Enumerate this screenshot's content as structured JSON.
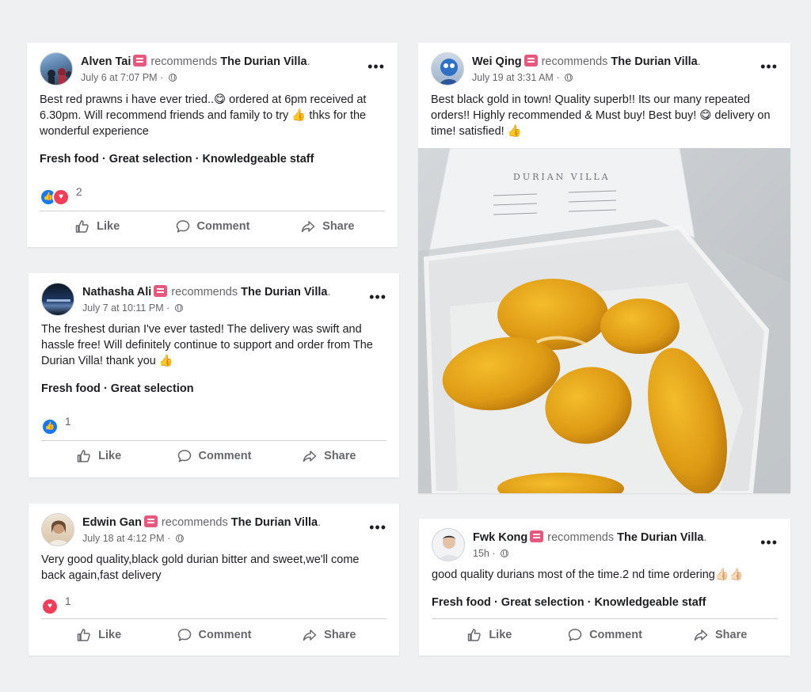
{
  "posts": [
    {
      "author": "Alven Tai",
      "recommends": "recommends",
      "page": "The Durian Villa",
      "date": "July 6 at 7:07 PM",
      "text": "Best red prawns i have ever tried..😋 ordered at 6pm received at 6.30pm. Will recommend friends and family to try 👍 thks for the wonderful experience",
      "tags": "Fresh food · Great selection · Knowledgeable staff",
      "reaction_count": "2",
      "reactions": [
        "like",
        "love"
      ]
    },
    {
      "author": "Nathasha Ali",
      "recommends": "recommends",
      "page": "The Durian Villa",
      "date": "July 7 at 10:11 PM",
      "text": "The freshest durian I've ever tasted! The delivery was swift and hassle free! Will definitely continue to support and order from The Durian Villa! thank you 👍",
      "tags": "Fresh food · Great selection",
      "reaction_count": "1",
      "reactions": [
        "like"
      ]
    },
    {
      "author": "Edwin Gan",
      "recommends": "recommends",
      "page": "The Durian Villa",
      "date": "July 18 at 4:12 PM",
      "text": "Very good quality,black gold durian bitter and sweet,we'll come back again,fast delivery",
      "reaction_count": "1",
      "reactions": [
        "love"
      ]
    },
    {
      "author": "Wei Qing",
      "recommends": "recommends",
      "page": "The Durian Villa",
      "date": "July 19 at 3:31 AM",
      "text": "Best black gold in town! Quality superb!! Its our many repeated orders!! Highly recommended & Must buy!  Best buy! 😋 delivery on time! satisfied! 👍"
    },
    {
      "author": "Fwk Kong",
      "recommends": "recommends",
      "page": "The Durian Villa",
      "date": "15h",
      "text": "good quality durians most of the time.2 nd time ordering👍🏻👍🏻",
      "tags": "Fresh food · Great selection · Knowledgeable staff"
    }
  ],
  "actions": {
    "like": "Like",
    "comment": "Comment",
    "share": "Share"
  },
  "photo_brand": "DURIAN VILLA",
  "colors": {
    "accent": "#1877f2",
    "love": "#f33e58",
    "badge": "#e8577e",
    "muted": "#65676b"
  }
}
